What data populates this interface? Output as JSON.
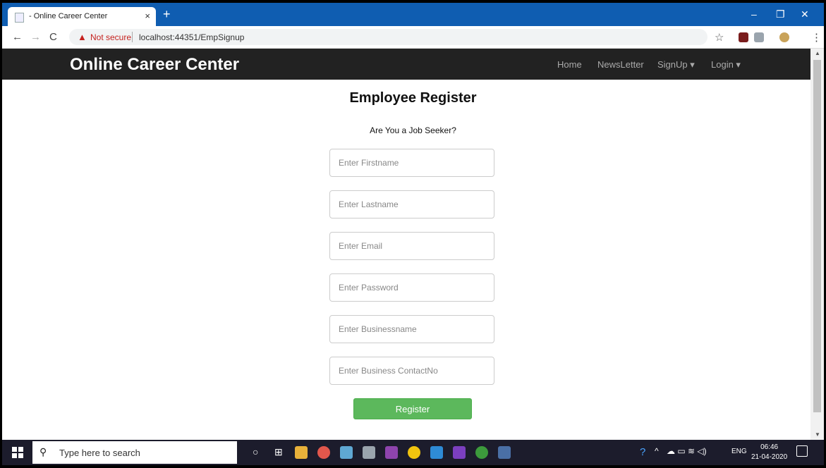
{
  "browser": {
    "tab_title": "- Online Career Center",
    "tab_close": "×",
    "new_tab": "+",
    "not_secure": "Not secure",
    "url": "localhost:44351/EmpSignup",
    "win_minimize": "–",
    "win_restore": "❐",
    "win_close": "✕"
  },
  "site": {
    "brand": "Online Career Center",
    "nav": [
      "Home",
      "NewsLetter",
      "SignUp ▾",
      "Login ▾"
    ]
  },
  "form": {
    "title": "Employee Register",
    "subtitle": "Are You a Job Seeker?",
    "firstname_placeholder": "Enter Firstname",
    "lastname_placeholder": "Enter Lastname",
    "email_placeholder": "Enter Email",
    "password_placeholder": "Enter Password",
    "businessname_placeholder": "Enter Businessname",
    "contact_placeholder": "Enter Business ContactNo",
    "register_label": "Register"
  },
  "taskbar": {
    "search_placeholder": "Type here to search",
    "tray_lang": "ENG",
    "time": "06:46",
    "date": "21-04-2020"
  },
  "colors": {
    "titlebar": "#0f5db1",
    "navbar": "#222222",
    "register_button": "#5cb85c"
  }
}
